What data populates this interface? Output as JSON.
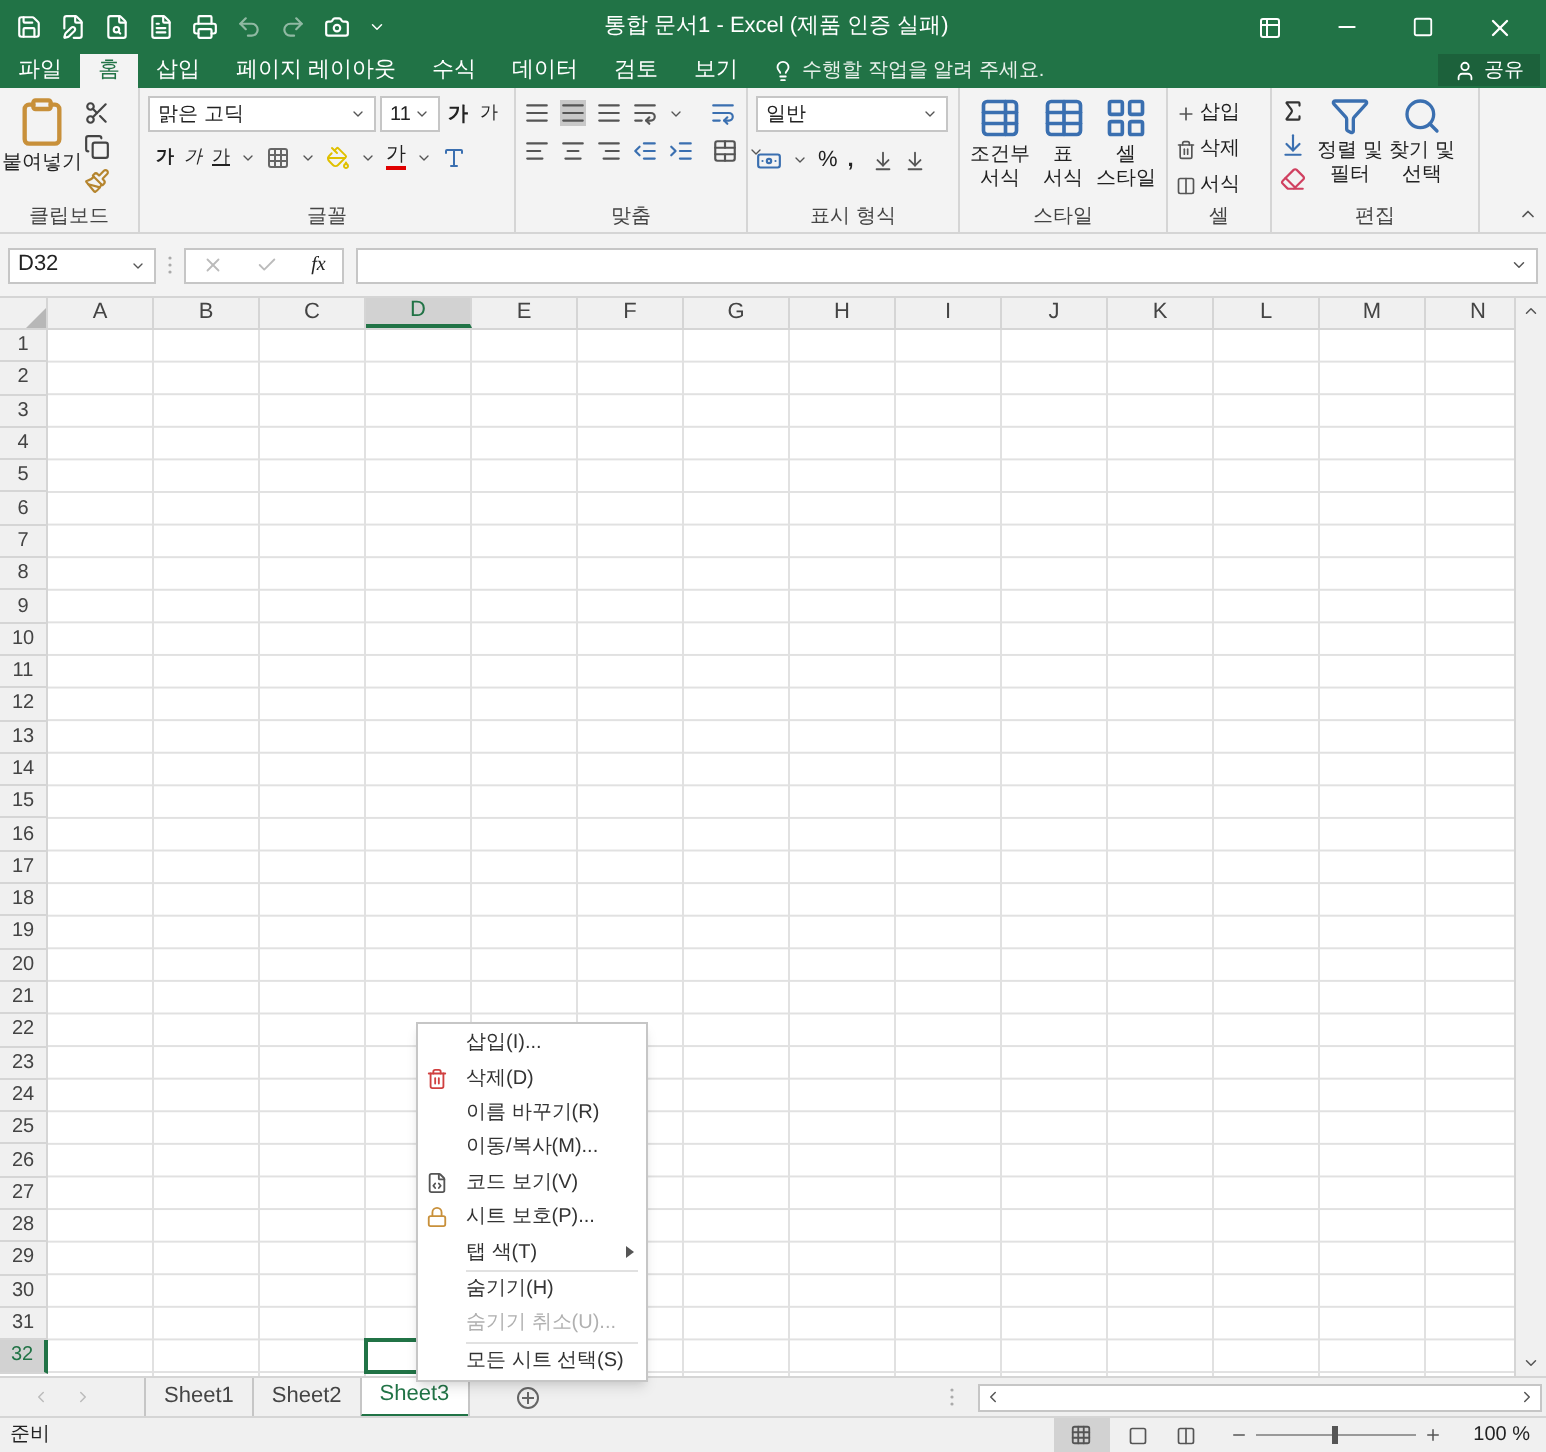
{
  "title_bar": {
    "title": "통합 문서1 - Excel (제품 인증 실패)"
  },
  "tabs": [
    {
      "label": "파일",
      "selected": false
    },
    {
      "label": "홈",
      "selected": true
    },
    {
      "label": "삽입",
      "selected": false
    },
    {
      "label": "페이지 레이아웃",
      "selected": false
    },
    {
      "label": "수식",
      "selected": false
    },
    {
      "label": "데이터",
      "selected": false
    },
    {
      "label": "검토",
      "selected": false
    },
    {
      "label": "보기",
      "selected": false
    }
  ],
  "tell_me": "수행할 작업을 알려 주세요.",
  "share": "공유",
  "ribbon": {
    "clipboard": {
      "paste": "붙여넣기",
      "label": "클립보드"
    },
    "font": {
      "font_name": "맑은 고딕",
      "font_size": "11",
      "grow": "가",
      "shrink": "가",
      "bold": "가",
      "italic": "가",
      "underline": "가",
      "font_color": "가",
      "label": "글꼴"
    },
    "alignment": {
      "label": "맞춤"
    },
    "number": {
      "format": "일반",
      "percent": "%",
      "comma": ",",
      "label": "표시 형식"
    },
    "styles": {
      "buttons": [
        {
          "line1": "조건부",
          "line2": "서식"
        },
        {
          "line1": "표",
          "line2": "서식"
        },
        {
          "line1": "셀",
          "line2": "스타일"
        }
      ],
      "label": "스타일"
    },
    "cells": {
      "buttons": [
        "삽입",
        "삭제",
        "서식"
      ],
      "label": "셀"
    },
    "editing": {
      "buttons": [
        {
          "line1": "정렬 및",
          "line2": "필터"
        },
        {
          "line1": "찾기 및",
          "line2": "선택"
        }
      ],
      "label": "편집"
    }
  },
  "formula_bar": {
    "name_box": "D32",
    "fx": "fx"
  },
  "columns": [
    {
      "label": "A",
      "selected": false
    },
    {
      "label": "B",
      "selected": false
    },
    {
      "label": "C",
      "selected": false
    },
    {
      "label": "D",
      "selected": true
    },
    {
      "label": "E",
      "selected": false
    },
    {
      "label": "F",
      "selected": false
    },
    {
      "label": "G",
      "selected": false
    },
    {
      "label": "H",
      "selected": false
    },
    {
      "label": "I",
      "selected": false
    },
    {
      "label": "J",
      "selected": false
    },
    {
      "label": "K",
      "selected": false
    },
    {
      "label": "L",
      "selected": false
    },
    {
      "label": "M",
      "selected": false
    },
    {
      "label": "N",
      "selected": false
    }
  ],
  "rows": [
    {
      "label": "1",
      "selected": false
    },
    {
      "label": "2",
      "selected": false
    },
    {
      "label": "3",
      "selected": false
    },
    {
      "label": "4",
      "selected": false
    },
    {
      "label": "5",
      "selected": false
    },
    {
      "label": "6",
      "selected": false
    },
    {
      "label": "7",
      "selected": false
    },
    {
      "label": "8",
      "selected": false
    },
    {
      "label": "9",
      "selected": false
    },
    {
      "label": "10",
      "selected": false
    },
    {
      "label": "11",
      "selected": false
    },
    {
      "label": "12",
      "selected": false
    },
    {
      "label": "13",
      "selected": false
    },
    {
      "label": "14",
      "selected": false
    },
    {
      "label": "15",
      "selected": false
    },
    {
      "label": "16",
      "selected": false
    },
    {
      "label": "17",
      "selected": false
    },
    {
      "label": "18",
      "selected": false
    },
    {
      "label": "19",
      "selected": false
    },
    {
      "label": "20",
      "selected": false
    },
    {
      "label": "21",
      "selected": false
    },
    {
      "label": "22",
      "selected": false
    },
    {
      "label": "23",
      "selected": false
    },
    {
      "label": "24",
      "selected": false
    },
    {
      "label": "25",
      "selected": false
    },
    {
      "label": "26",
      "selected": false
    },
    {
      "label": "27",
      "selected": false
    },
    {
      "label": "28",
      "selected": false
    },
    {
      "label": "29",
      "selected": false
    },
    {
      "label": "30",
      "selected": false
    },
    {
      "label": "31",
      "selected": false
    },
    {
      "label": "32",
      "selected": true
    }
  ],
  "context_menu": [
    {
      "kind": "item",
      "label": "삽입(I)...",
      "disabled": false
    },
    {
      "kind": "item",
      "label": "삭제(D)",
      "disabled": false
    },
    {
      "kind": "item",
      "label": "이름 바꾸기(R)",
      "disabled": false
    },
    {
      "kind": "item",
      "label": "이동/복사(M)...",
      "disabled": false
    },
    {
      "kind": "item",
      "label": "코드 보기(V)",
      "disabled": false
    },
    {
      "kind": "item",
      "label": "시트 보호(P)...",
      "disabled": false
    },
    {
      "kind": "submenu",
      "label": "탭 색(T)",
      "disabled": false
    },
    {
      "kind": "separator"
    },
    {
      "kind": "item",
      "label": "숨기기(H)",
      "disabled": false
    },
    {
      "kind": "item",
      "label": "숨기기 취소(U)...",
      "disabled": true
    },
    {
      "kind": "separator"
    },
    {
      "kind": "item",
      "label": "모든 시트 선택(S)",
      "disabled": false
    }
  ],
  "sheet_tabs": [
    {
      "label": "Sheet1",
      "selected": false
    },
    {
      "label": "Sheet2",
      "selected": false
    },
    {
      "label": "Sheet3",
      "selected": true
    }
  ],
  "status_bar": {
    "status": "준비",
    "zoom_slider": {
      "level": 0.5
    },
    "zoom": "100 %"
  }
}
